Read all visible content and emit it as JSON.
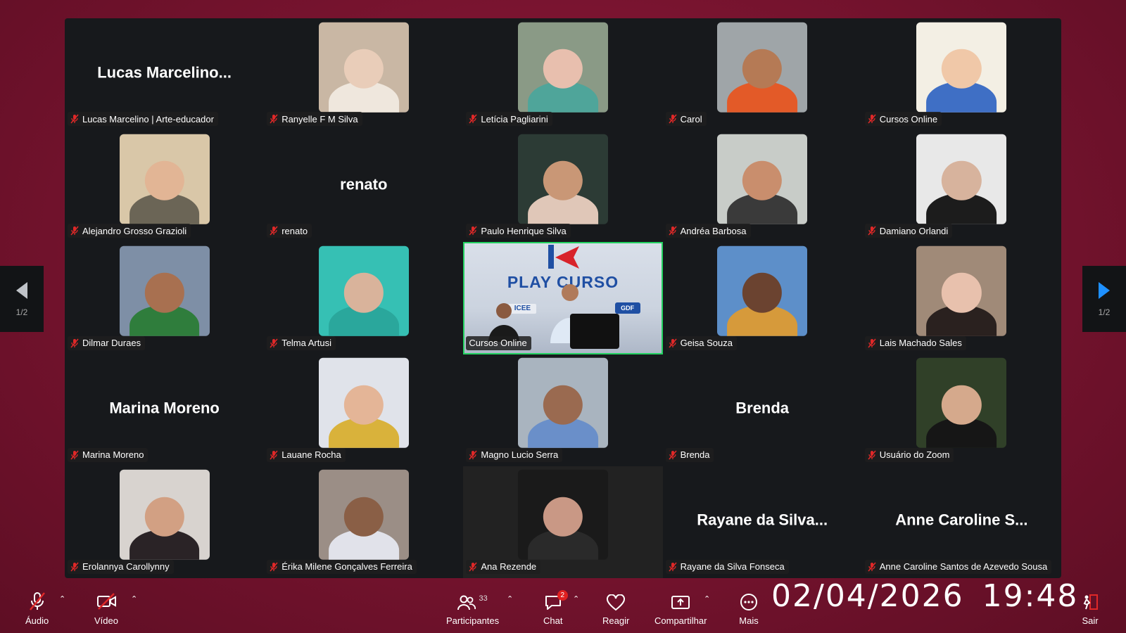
{
  "pagination": {
    "label": "1/2"
  },
  "participants": [
    {
      "name": "Lucas Marcelino | Arte-educador",
      "display": "Lucas  Marcelino...",
      "video": false
    },
    {
      "name": "Ranyelle F M Silva",
      "video": true,
      "bg": "#c9b7a4",
      "skin": "#e9cdb9",
      "shirt": "#efe7dd"
    },
    {
      "name": "Letícia Pagliarini",
      "video": true,
      "bg": "#8a9a86",
      "skin": "#e8bfae",
      "shirt": "#4fa59a"
    },
    {
      "name": "Carol",
      "video": true,
      "bg": "#9fa5a8",
      "skin": "#b57a55",
      "shirt": "#e35a28"
    },
    {
      "name": "Cursos Online",
      "video": true,
      "bg": "#f3efe4",
      "skin": "#f0c8a8",
      "shirt": "#3f6fc5"
    },
    {
      "name": "Alejandro Grosso Grazioli",
      "video": true,
      "bg": "#d9c7a8",
      "skin": "#e2b595",
      "shirt": "#6b6556"
    },
    {
      "name": "renato",
      "display": "renato",
      "video": false
    },
    {
      "name": "Paulo Henrique Silva",
      "video": true,
      "bg": "#2c3b35",
      "skin": "#c99776",
      "shirt": "#e0c7b8"
    },
    {
      "name": "Andréa Barbosa",
      "video": true,
      "bg": "#c8ccc8",
      "skin": "#c98e6d",
      "shirt": "#3a3a3a"
    },
    {
      "name": "Damiano Orlandi",
      "video": true,
      "bg": "#e8e8e8",
      "skin": "#d7b39d",
      "shirt": "#1c1c1c"
    },
    {
      "name": "Dilmar Duraes",
      "video": true,
      "bg": "#7e8fa6",
      "skin": "#a87050",
      "shirt": "#2f7d3c"
    },
    {
      "name": "Telma Artusi",
      "video": true,
      "bg": "#36c0b4",
      "skin": "#d9b39b",
      "shirt": "#2aa79c"
    },
    {
      "name": "Cursos Online",
      "video": true,
      "active": true,
      "special": "playcurso"
    },
    {
      "name": "Geisa Souza",
      "video": true,
      "bg": "#5d8fc9",
      "skin": "#6b4330",
      "shirt": "#d69a3b"
    },
    {
      "name": "Lais Machado Sales",
      "video": true,
      "bg": "#a08a78",
      "skin": "#e8c1ad",
      "shirt": "#2a211f"
    },
    {
      "name": "Marina Moreno",
      "display": "Marina Moreno",
      "video": false
    },
    {
      "name": "Lauane Rocha",
      "video": true,
      "bg": "#e0e3ea",
      "skin": "#e4b597",
      "shirt": "#d9b23b"
    },
    {
      "name": "Magno Lucio Serra",
      "video": true,
      "bg": "#a9b4bf",
      "skin": "#9a6a50",
      "shirt": "#6a8fc9"
    },
    {
      "name": "Brenda",
      "display": "Brenda",
      "video": false
    },
    {
      "name": "Usuário do Zoom",
      "video": true,
      "bg": "#304028",
      "skin": "#d5a98c",
      "shirt": "#161616"
    },
    {
      "name": "Erolannya Carollynny",
      "video": true,
      "bg": "#d8d3cf",
      "skin": "#d2a083",
      "shirt": "#2a2326"
    },
    {
      "name": "Érika Milene Gonçalves Ferreira",
      "video": true,
      "bg": "#9b8e86",
      "skin": "#8a5f46",
      "shirt": "#e1e2ea"
    },
    {
      "name": "Ana Rezende",
      "video": true,
      "dark": true,
      "bg": "#1a1a1a",
      "skin": "#c99885",
      "shirt": "#2a2a2a"
    },
    {
      "name": "Rayane da Silva Fonseca",
      "display": "Rayane da Silva...",
      "video": false
    },
    {
      "name": "Anne Caroline Santos de Azevedo Sousa",
      "display": "Anne Caroline S...",
      "video": false
    }
  ],
  "playcurso": {
    "title": "PLAY CURSO",
    "icee": "ICEE",
    "gdf": "GDF"
  },
  "toolbar": {
    "audio_label": "Áudio",
    "video_label": "Vídeo",
    "participants_label": "Participantes",
    "participants_count": "33",
    "chat_label": "Chat",
    "chat_badge": "2",
    "react_label": "Reagir",
    "share_label": "Compartilhar",
    "more_label": "Mais",
    "leave_label": "Sair"
  },
  "clock": {
    "date": "02/04/2026",
    "time": "19:48"
  },
  "colors": {
    "accent_active": "#23d160",
    "background": "#7a1430",
    "muted_red": "#e02828"
  }
}
